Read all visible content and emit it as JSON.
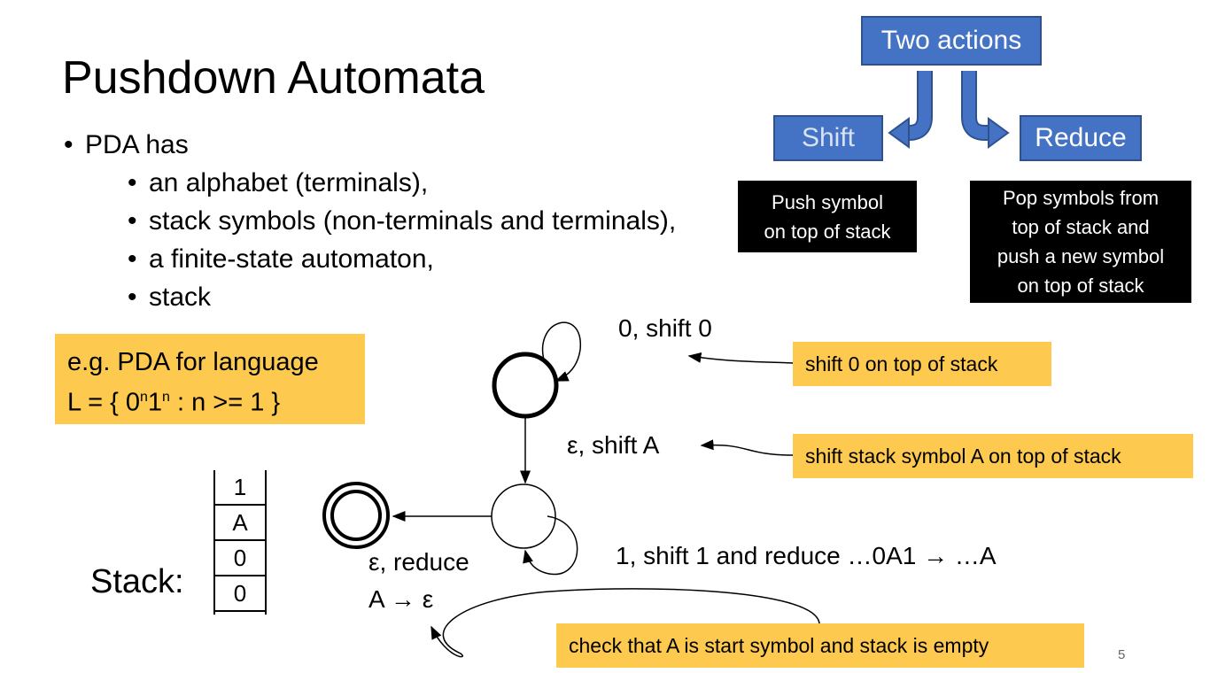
{
  "slide": {
    "title": "Pushdown Automata",
    "page_number": "5"
  },
  "bullets": {
    "top": "PDA has",
    "items": [
      "an alphabet (terminals),",
      "stack symbols (non-terminals and terminals),",
      "a finite-state automaton,",
      "stack"
    ]
  },
  "actions": {
    "header": "Two actions",
    "shift_label": "Shift",
    "reduce_label": "Reduce",
    "shift_desc": [
      "Push symbol",
      "on top of stack"
    ],
    "reduce_desc": [
      "Pop symbols from",
      "top of stack and",
      "push a new symbol",
      "on top of stack"
    ]
  },
  "example": {
    "line1": "e.g. PDA for language",
    "line2_prefix": "L = { 0",
    "line2_sup1": "n",
    "line2_mid": "1",
    "line2_sup2": "n",
    "line2_suffix": " : n >= 1 }"
  },
  "transitions": {
    "loop_top": "0, shift 0",
    "eps_shift": "ε, shift A",
    "loop_bottom": "1, shift 1 and reduce …0A1 → …A",
    "reduce_line1": "ε, reduce",
    "reduce_line2": "A → ε"
  },
  "callouts": {
    "shift0": "shift 0 on top of stack",
    "shiftA": "shift stack symbol A on top of stack",
    "check": "check that A is start symbol and stack is empty"
  },
  "stack": {
    "label": "Stack:",
    "cells": [
      "1",
      "A",
      "0",
      "0"
    ]
  },
  "colors": {
    "blue": "#4472c4",
    "yellow": "#fdc94e",
    "black": "#000000"
  }
}
